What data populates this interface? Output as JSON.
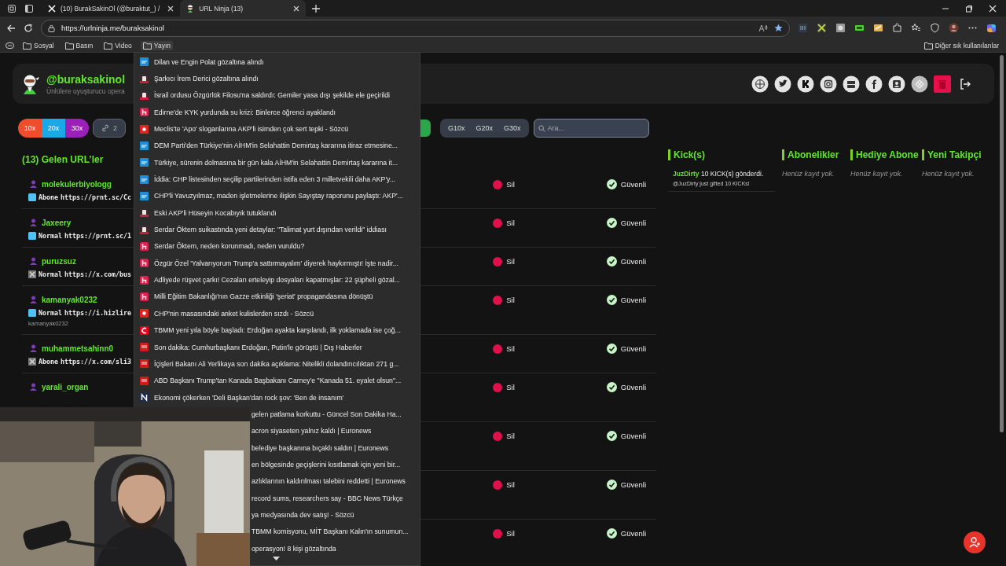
{
  "browser": {
    "tabs": [
      {
        "title": "(10) BurakSakinOl (@buraktut_) /",
        "kind": "x",
        "selected": false
      },
      {
        "title": "URL Ninja (13)",
        "kind": "ninja",
        "selected": true
      }
    ],
    "address": "https://urlninja.me/buraksakinol",
    "bookmarks": [
      {
        "label": "Sosyal",
        "open": false
      },
      {
        "label": "Basın",
        "open": false
      },
      {
        "label": "Video",
        "open": false
      },
      {
        "label": "Yayın",
        "open": true
      }
    ],
    "other_bookmarks": "Diğer sık kullanılanlar"
  },
  "header": {
    "handle": "@buraksakinol",
    "subtitle": "Ünlülere uyuşturucu opera"
  },
  "toolbar": {
    "multipliers": [
      {
        "label": "10x",
        "color": "#f04e2a"
      },
      {
        "label": "20x",
        "color": "#1ba8e8"
      },
      {
        "label": "30x",
        "color": "#9b1fb9"
      }
    ],
    "link_count": "2",
    "gift_filters": [
      "G10x",
      "G20x",
      "G30x"
    ],
    "search": {
      "placeholder": "Ara..."
    }
  },
  "urls": {
    "title": "(13) Gelen URL’ler",
    "rows": [
      {
        "user": "molekulerbiyologg",
        "kind": "prnt",
        "type": "Abone",
        "url": "https://prnt.sc/Cc",
        "delete": "Sil",
        "status": "Güvenli"
      },
      {
        "user": "Jaxeery",
        "kind": "prnt",
        "type": "Normal",
        "url": "https://prnt.sc/1",
        "delete": "Sil",
        "status": "Güvenli"
      },
      {
        "user": "puruzsuz",
        "kind": "x",
        "type": "Normal",
        "url": "https://x.com/bus",
        "delete": "Sil",
        "status": "Güvenli"
      },
      {
        "user": "kamanyak0232",
        "kind": "prnt",
        "type": "Normal",
        "url": "https://i.hizlire",
        "note": "kamanyak0232",
        "delete": "Sil",
        "status": "Güvenli"
      },
      {
        "user": "muhammetsahinn0",
        "kind": "x",
        "type": "Abone",
        "url": "https://x.com/sli3",
        "delete": "Sil",
        "status": "Güvenli"
      },
      {
        "user": "yarali_organ",
        "delete": "Sil",
        "status": "Güvenli"
      },
      {
        "delete": "Sil",
        "status": "Güvenli"
      },
      {
        "delete": "Sil",
        "status": "Güvenli"
      },
      {
        "delete": "Sil",
        "status": "Güvenli"
      }
    ]
  },
  "panels": [
    {
      "title": "Kick(s)",
      "entries": [
        {
          "user": "JuzDirty",
          "text": "10 KICK(s) gönderdi.",
          "note": "@JuzDirty just gifted 10 KICKs!"
        }
      ]
    },
    {
      "title": "Abonelikler",
      "empty": "Henüz kayıt yok."
    },
    {
      "title": "Hediye Abone",
      "empty": "Henüz kayıt yok."
    },
    {
      "title": "Yeni Takipçi",
      "empty": "Henüz kayıt yok."
    }
  ],
  "menu": {
    "items": [
      {
        "kind": "t24",
        "text": "Dilan ve Engin Polat gözaltına alındı"
      },
      {
        "kind": "b",
        "text": "Şarkıcı İrem Derici gözaltına alındı"
      },
      {
        "kind": "b",
        "text": "İsrail ordusu Özgürlük Filosu'na saldırdı: Gemiler yasa dışı şekilde ele geçirildi"
      },
      {
        "kind": "h",
        "text": "Edirne'de KYK yurdunda su krizi: Binlerce öğrenci ayaklandı"
      },
      {
        "kind": "sozcu",
        "text": "Meclis'te 'Apo' sloganlarına AKP'li isimden çok sert tepki - Sözcü"
      },
      {
        "kind": "t24",
        "text": "DEM Parti'den Türkiye'nin AİHM'in Selahattin Demirtaş kararına itiraz etmesine..."
      },
      {
        "kind": "t24",
        "text": "Türkiye, sürenin dolmasına bir gün kala AİHM'in Selahattin Demirtaş kararına it..."
      },
      {
        "kind": "t24",
        "text": "İddia: CHP listesinden seçilip partilerinden istifa eden 3 milletvekili daha AKP'y..."
      },
      {
        "kind": "t24",
        "text": "CHP'li Yavuzyılmaz, maden işletmelerine ilişkin Sayıştay raporunu paylaştı: AKP'..."
      },
      {
        "kind": "b",
        "text": "Eski AKP'li Hüseyin Kocabıyık tutuklandı"
      },
      {
        "kind": "b",
        "text": "Serdar Öktem suikastında yeni detaylar: \"Talimat yurt dışından verildi\" iddiası"
      },
      {
        "kind": "h",
        "text": "Serdar Öktem, neden korunmadı, neden vuruldu?"
      },
      {
        "kind": "h",
        "text": "Özgür Özel 'Yalvarıyorum Trump'a sattırmayalım' diyerek haykırmıştı! İşte nadir..."
      },
      {
        "kind": "h",
        "text": "Adliyede rüşvet çarkı! Cezaları erteleyip dosyaları kapatmışlar: 22 şüpheli gözal..."
      },
      {
        "kind": "h",
        "text": "Milli Eğitim Bakanlığı'nın Gazze etkinliği 'şeriat' propagandasına dönüştü"
      },
      {
        "kind": "sozcu",
        "text": "CHP'nin masasındaki anket kulislerden sızdı - Sözcü"
      },
      {
        "kind": "c",
        "text": "TBMM yeni yıla böyle başladı: Erdoğan ayakta karşılandı, ilk yoklamada ise çoğ..."
      },
      {
        "kind": "ntv",
        "text": "Son dakika: Cumhurbaşkanı Erdoğan, Putin'le görüştü | Dış Haberler"
      },
      {
        "kind": "ntv",
        "text": "İçişleri Bakanı Ali Yerlikaya son dakika açıklama: Nitelikli dolandırıcılıktan 271 g..."
      },
      {
        "kind": "ntv",
        "text": "ABD Başkanı Trump'tan Kanada Başbakanı Carney'e \"Kanada 51. eyalet olsun\"..."
      },
      {
        "kind": "n",
        "text": "Ekonomi çökerken 'Deli Başkan'dan rock şov: 'Ben de insanım'"
      },
      {
        "text": "gelen patlama korkuttu - Güncel Son Dakika Ha..."
      },
      {
        "text": "acron siyaseten yalnız kaldı | Euronews"
      },
      {
        "text": "belediye başkanına bıçaklı saldırı | Euronews"
      },
      {
        "text": "en bölgesinde geçişlerini kısıtlamak için yeni bir..."
      },
      {
        "text": "azlıklarının kaldırılması talebini reddetti | Euronews"
      },
      {
        "text": "record sums, researchers say - BBC News Türkçe"
      },
      {
        "text": "ya medyasında dev satış! - Sözcü"
      },
      {
        "text": "TBMM komisyonu, MİT Başkanı Kalın'ın sunumun..."
      },
      {
        "text": "operasyon! 8 kişi gözaltında"
      }
    ]
  }
}
